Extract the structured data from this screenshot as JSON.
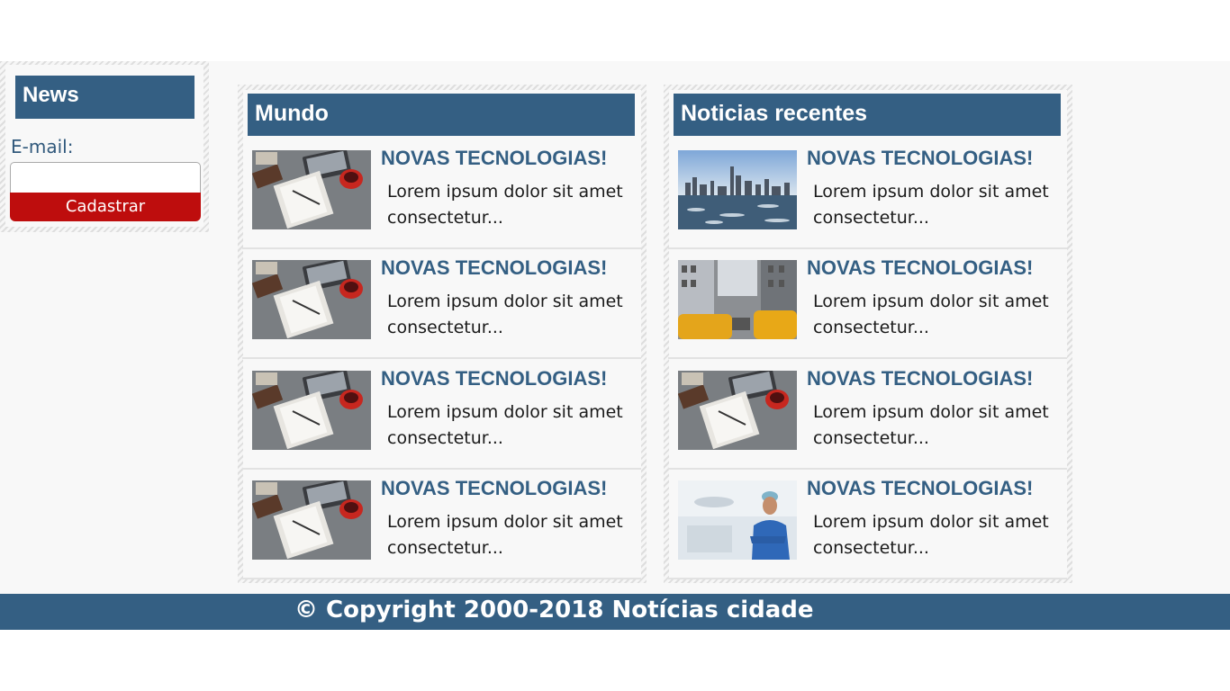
{
  "sidebar": {
    "title": "News",
    "email_label": "E-mail:",
    "email_value": "",
    "button_label": "Cadastrar"
  },
  "columns": [
    {
      "title": "Mundo",
      "items": [
        {
          "title": "NOVAS TECNOLOGIAS!",
          "desc": "Lorem ipsum dolor sit amet consectetur...",
          "image": "desk-workspace"
        },
        {
          "title": "NOVAS TECNOLOGIAS!",
          "desc": "Lorem ipsum dolor sit amet consectetur...",
          "image": "desk-workspace"
        },
        {
          "title": "NOVAS TECNOLOGIAS!",
          "desc": "Lorem ipsum dolor sit amet consectetur...",
          "image": "desk-workspace"
        },
        {
          "title": "NOVAS TECNOLOGIAS!",
          "desc": "Lorem ipsum dolor sit amet consectetur...",
          "image": "desk-workspace"
        }
      ]
    },
    {
      "title": "Noticias recentes",
      "items": [
        {
          "title": "NOVAS TECNOLOGIAS!",
          "desc": "Lorem ipsum dolor sit amet consectetur...",
          "image": "city-skyline"
        },
        {
          "title": "NOVAS TECNOLOGIAS!",
          "desc": "Lorem ipsum dolor sit amet consectetur...",
          "image": "city-taxis"
        },
        {
          "title": "NOVAS TECNOLOGIAS!",
          "desc": "Lorem ipsum dolor sit amet consectetur...",
          "image": "desk-workspace"
        },
        {
          "title": "NOVAS TECNOLOGIAS!",
          "desc": "Lorem ipsum dolor sit amet consectetur...",
          "image": "surgeon"
        }
      ]
    }
  ],
  "footer": {
    "text": "© Copyright 2000-2018 Notícias cidade"
  },
  "colors": {
    "primary": "#345f83",
    "button": "#be0d0d",
    "background": "#f8f8f8"
  }
}
